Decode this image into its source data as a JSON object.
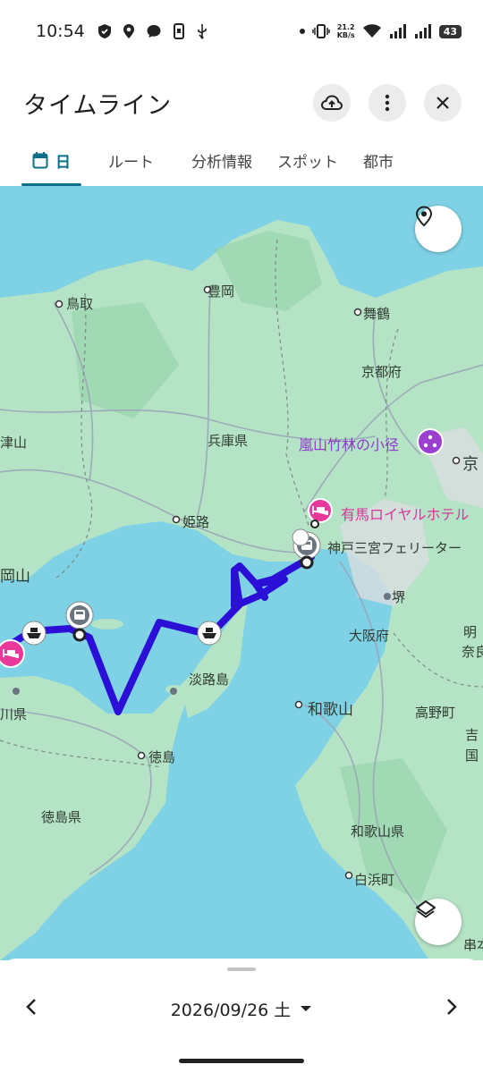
{
  "status_bar": {
    "time": "10:54",
    "net_speed_value": "21.2",
    "net_speed_unit": "KB/s",
    "battery": "43"
  },
  "header": {
    "title": "タイムライン",
    "icons": [
      "cloud-upload-icon",
      "more-vert-icon",
      "close-icon"
    ]
  },
  "tabs": [
    {
      "label": "日",
      "icon": "calendar-icon",
      "active": true
    },
    {
      "label": "ルート"
    },
    {
      "label": "分析情報"
    },
    {
      "label": "スポット"
    },
    {
      "label": "都市"
    }
  ],
  "map": {
    "labels": {
      "toyooka": "豊岡",
      "tottori": "鳥取",
      "maizuru": "舞鶴",
      "kyotofu": "京都府",
      "tsuyama": "津山",
      "hyogo": "兵庫県",
      "arashiyama": "嵐山竹林の小径",
      "kyo": "京",
      "himeji": "姫路",
      "arima": "有馬ロイヤルホテル",
      "kobe_ferry": "神戸三宮フェリーター",
      "okayama": "岡山",
      "sakai": "堺",
      "osakafu": "大阪府",
      "awajishima": "淡路島",
      "nara": "奈良",
      "kagawa": "川県",
      "wakayama": "和歌山",
      "koyacho": "高野町",
      "tokushima": "徳島",
      "tokushimaken": "徳島県",
      "wakayamaken": "和歌山県",
      "shirahama": "白浜町",
      "yoshi": "吉",
      "kuni": "国",
      "kushimoto": "串本",
      "ake": "明"
    },
    "route_color": "#2b0fd6",
    "icons": [
      "location-pin-icon",
      "layers-icon",
      "train-icon",
      "ferry-icon",
      "hotel-icon",
      "attraction-icon"
    ]
  },
  "bottom": {
    "date": "2026/09/26 土",
    "prev_icon": "chevron-left-icon",
    "next_icon": "chevron-right-icon"
  }
}
